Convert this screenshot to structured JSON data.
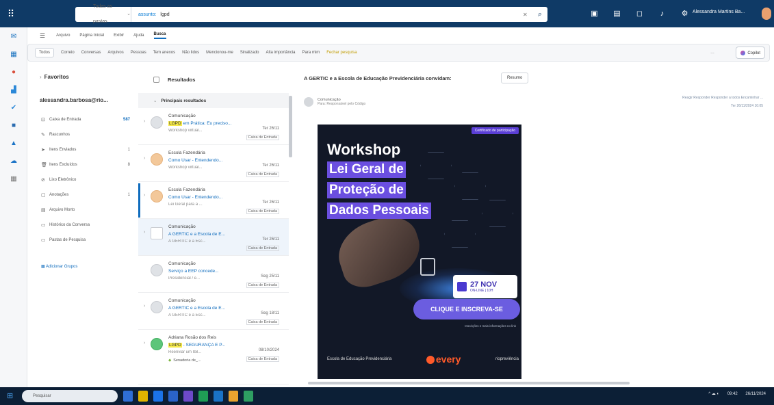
{
  "topbar": {
    "search_scope": "Todas as pastas",
    "search_field": "assunto:",
    "search_query": "lgpd",
    "user_name": "Alessandra Martins Ba...",
    "icons": [
      "teams-icon",
      "notes-icon",
      "chat-icon",
      "bell-icon",
      "gear-icon"
    ]
  },
  "menu": {
    "items": [
      "Arquivo",
      "Página Inicial",
      "Exibir",
      "Ajuda",
      "Busca"
    ],
    "active": "Busca"
  },
  "ribbon": {
    "chips": [
      "Todos",
      "Correio",
      "Conversas",
      "Arquivos",
      "Pessoas"
    ],
    "actions": [
      "Tem anexos",
      "Não lidos",
      "Mencionou-me",
      "Sinalizado",
      "Alta importância",
      "Para mim",
      "Fechar pesquisa"
    ],
    "copilot": "Copilot"
  },
  "folders": {
    "favorites_label": "Favoritos",
    "account": "alessandra.barbosa@rio...",
    "items": [
      {
        "label": "Caixa de Entrada",
        "count": "587"
      },
      {
        "label": "Rascunhos",
        "count": ""
      },
      {
        "label": "Itens Enviados",
        "count": "1"
      },
      {
        "label": "Itens Excluídos",
        "count": "8"
      },
      {
        "label": "Lixo Eletrônico",
        "count": ""
      },
      {
        "label": "Anotações",
        "count": "1"
      },
      {
        "label": "Arquivo Morto",
        "count": ""
      },
      {
        "label": "Histórico da Conversa",
        "count": ""
      },
      {
        "label": "Pastas de Pesquisa",
        "count": ""
      }
    ],
    "groups_link": "Adicionar Grupos"
  },
  "list": {
    "header": "Resultados",
    "section": "Principais resultados",
    "messages": [
      {
        "from": "Comunicação",
        "hl": "LGPD",
        "subject": "em Prática: Eu preciso...",
        "date": "Ter 26/11",
        "snippet": "Workshop virtual...",
        "folder": "Caixa de Entrada",
        "avatar": "gray",
        "unread": false
      },
      {
        "from": "Escola Fazendária",
        "hl": "",
        "subject": "Como Usar - Entendendo...",
        "date": "Ter 26/11",
        "snippet": "Workshop virtual...",
        "folder": "Caixa de Entrada",
        "avatar": "orange",
        "unread": false
      },
      {
        "from": "Escola Fazendária",
        "hl": "",
        "subject": "Como Usar - Entendendo...",
        "date": "Ter 26/11",
        "snippet": "Lei Geral para a ...",
        "folder": "Caixa de Entrada",
        "avatar": "orange",
        "unread": true
      },
      {
        "from": "Comunicação",
        "hl": "",
        "subject": "A GERTIC e a Escola de E...",
        "date": "Ter 26/11",
        "snippet": "A GERTIC e a Esc...",
        "folder": "Caixa de Entrada",
        "avatar": "gray",
        "unread": false
      },
      {
        "from": "Comunicação",
        "hl": "",
        "subject": "Serviço a EEP concede...",
        "date": "Seg 25/11",
        "snippet": "Presidencial / e...",
        "folder": "Caixa de Entrada",
        "avatar": "gray",
        "unread": false
      },
      {
        "from": "Comunicação",
        "hl": "",
        "subject": "A GERTIC e a Escola de E...",
        "date": "Seg 18/11",
        "snippet": "A GERTIC e a Esc...",
        "folder": "Caixa de Entrada",
        "avatar": "gray",
        "unread": false
      },
      {
        "from": "Adriana Rosão dos Reis",
        "hl": "LGPD",
        "subject": "- SEGURANÇA E P...",
        "date": "08/10/2024",
        "snippet": "Reenviar um Ibil...",
        "folder": "Caixa de Entrada",
        "avatar": "green",
        "unread": false,
        "attachment": "Senadoria de_..."
      }
    ]
  },
  "reading": {
    "subject": "A GERTIC e a Escola de Educação Previdenciária convidam:",
    "summary_btn": "Resumo",
    "sender": "Comunicação",
    "to": "Para: Responsável pelo Código",
    "actions": "Reagir  Responder  Responder a todos  Encaminhar  ...",
    "date": "Ter 26/11/2024 10:05",
    "banner": {
      "cert": "Certificado de participação",
      "line0": "Workshop",
      "line1": "Lei Geral de",
      "line2": "Proteção de",
      "line3": "Dados Pessoais",
      "date_big": "27 NOV",
      "date_small": "ON-LINE | 10H",
      "cta": "CLIQUE E INSCREVA-SE",
      "small": "Inscrições e mais informações no link",
      "logo1": "Escola de Educação Previdenciária",
      "logo2": "every",
      "logo3": "riopreviência"
    }
  },
  "taskbar": {
    "search": "Pesquisar",
    "clock": "09:42",
    "date": "26/11/2024"
  }
}
